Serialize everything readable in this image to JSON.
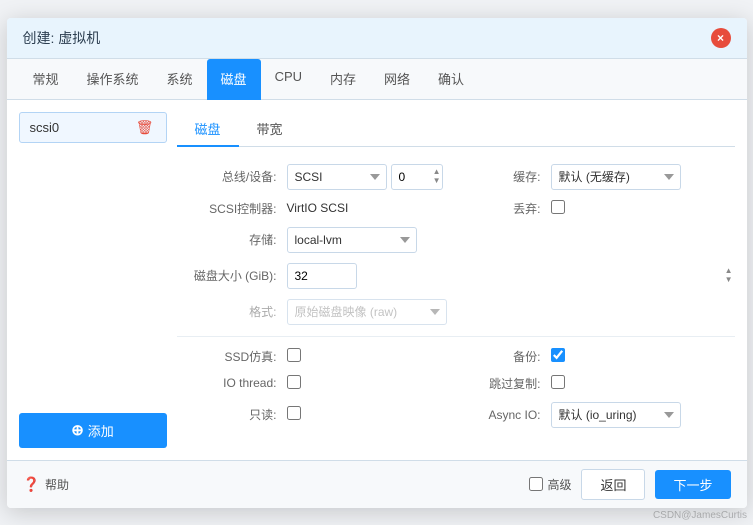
{
  "dialog": {
    "title": "创建: 虚拟机",
    "close_icon": "×"
  },
  "tabs": [
    {
      "label": "常规",
      "active": false
    },
    {
      "label": "操作系统",
      "active": false
    },
    {
      "label": "系统",
      "active": false
    },
    {
      "label": "磁盘",
      "active": true
    },
    {
      "label": "CPU",
      "active": false
    },
    {
      "label": "内存",
      "active": false
    },
    {
      "label": "网络",
      "active": false
    },
    {
      "label": "确认",
      "active": false
    }
  ],
  "left_panel": {
    "disk_items": [
      {
        "label": "scsi0"
      }
    ],
    "add_label": "添加"
  },
  "inner_tabs": [
    {
      "label": "磁盘",
      "active": true
    },
    {
      "label": "带宽",
      "active": false
    }
  ],
  "form": {
    "bus_device_label": "总线/设备:",
    "bus_value": "SCSI",
    "device_value": "0",
    "cache_label": "缓存:",
    "cache_value": "默认 (无缓存)",
    "scsi_controller_label": "SCSI控制器:",
    "scsi_controller_value": "VirtIO SCSI",
    "discard_label": "丢弃:",
    "storage_label": "存储:",
    "storage_value": "local-lvm",
    "disk_size_label": "磁盘大小 (GiB):",
    "disk_size_value": "32",
    "format_label": "格式:",
    "format_value": "原始磁盘映像 (raw)",
    "ssd_label": "SSD仿真:",
    "backup_label": "备份:",
    "io_thread_label": "IO thread:",
    "skip_replication_label": "跳过复制:",
    "readonly_label": "只读:",
    "async_io_label": "Async IO:",
    "async_io_value": "默认 (io_uring)"
  },
  "footer": {
    "help_label": "帮助",
    "advanced_label": "高级",
    "back_label": "返回",
    "next_label": "下一步"
  },
  "watermark": "CSDN@JamesCurtis"
}
